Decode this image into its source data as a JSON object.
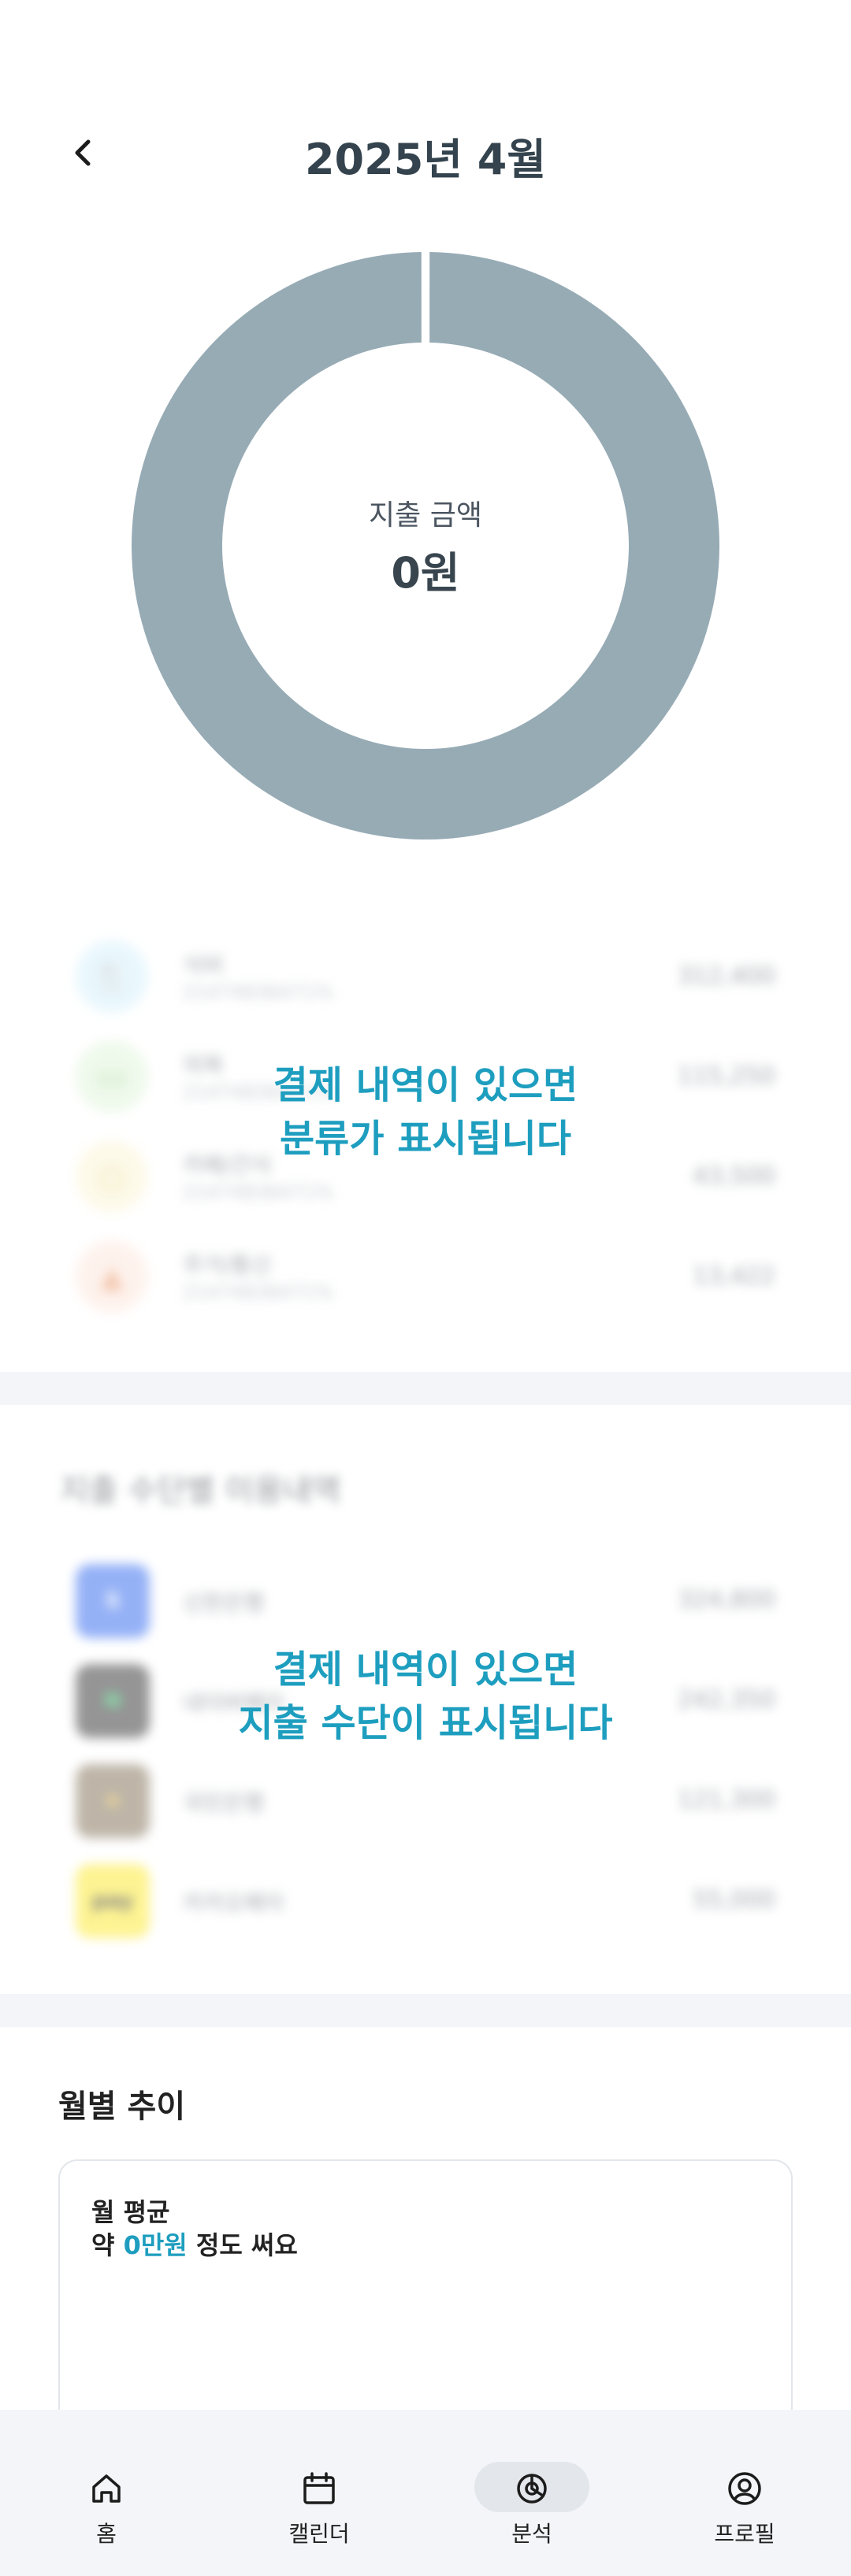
{
  "header": {
    "title": "2025년 4월"
  },
  "donut": {
    "label": "지출 금액",
    "value": "0원",
    "color": "#97abb5"
  },
  "categories": {
    "items": [
      {
        "name": "식비",
        "sub": "21474836471%",
        "amount": "312,400",
        "icon": "utensils-icon",
        "bg": "#d7f1fb",
        "fg": "#4fb8dc"
      },
      {
        "name": "의복",
        "sub": "21474836471%",
        "amount": "115,250",
        "icon": "shirt-icon",
        "bg": "#e2f5dc",
        "fg": "#7bc26a"
      },
      {
        "name": "카페/간식",
        "sub": "21474836471%",
        "amount": "43,500",
        "icon": "coffee-icon",
        "bg": "#fbf6d8",
        "fg": "#d8c24a"
      },
      {
        "name": "주거/통신",
        "sub": "21474836471%",
        "amount": "13,422",
        "icon": "home-icon",
        "bg": "#fde8de",
        "fg": "#eb9a6e"
      }
    ],
    "overlay_line1": "결제 내역이 있으면",
    "overlay_line2": "분류가 표시됩니다"
  },
  "payments": {
    "heading": "지출 수단별 이용내역",
    "items": [
      {
        "name": "신한은행",
        "amount": "324,800",
        "icon": "shinhan-logo-icon",
        "bg": "#3f73f0",
        "fg": "#ffffff",
        "mark": "S"
      },
      {
        "name": "네이버페이",
        "amount": "242,350",
        "icon": "naverpay-logo-icon",
        "bg": "#3f3f3f",
        "fg": "#29d36b",
        "mark": "N"
      },
      {
        "name": "국민은행",
        "amount": "121,300",
        "icon": "kb-logo-icon",
        "bg": "#8a7a62",
        "fg": "#f3c53a",
        "mark": "★"
      },
      {
        "name": "카카오페이",
        "amount": "55,000",
        "icon": "kakaopay-logo-icon",
        "bg": "#fcea3b",
        "fg": "#222222",
        "mark": "pay"
      }
    ],
    "overlay_line1": "결제 내역이 있으면",
    "overlay_line2": "지출 수단이 표시됩니다"
  },
  "monthly": {
    "title": "월별 추이",
    "avg_label": "월 평균",
    "avg_prefix": "약 ",
    "avg_value": "0만원",
    "avg_suffix": " 정도 써요"
  },
  "nav": [
    {
      "label": "홈",
      "icon": "home-icon",
      "active": false
    },
    {
      "label": "캘린더",
      "icon": "calendar-icon",
      "active": false
    },
    {
      "label": "분석",
      "icon": "analysis-icon",
      "active": true
    },
    {
      "label": "프로필",
      "icon": "profile-icon",
      "active": false
    }
  ],
  "colors": {
    "accent": "#1e9ebf",
    "section_bg": "#f3f5f9",
    "title": "#34434d"
  }
}
